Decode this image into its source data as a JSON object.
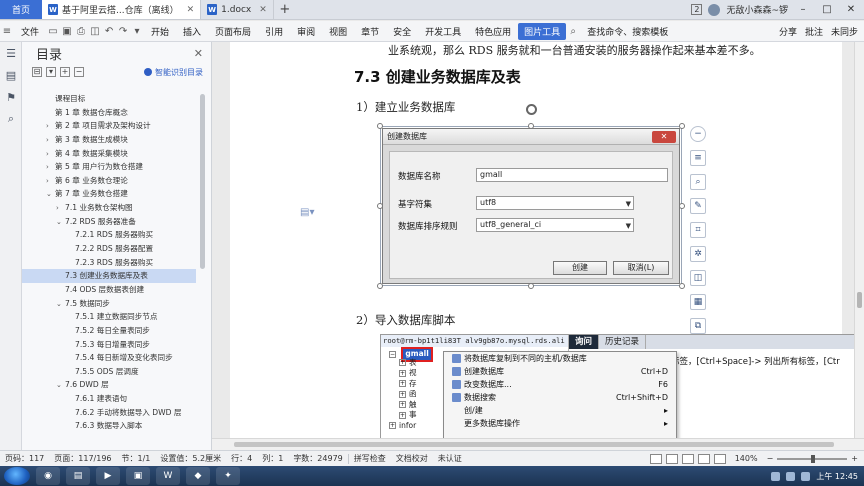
{
  "tabbar": {
    "home": "首页",
    "tabs": [
      {
        "label": "基于阿里云搭...仓库（离线）",
        "icon": "W"
      },
      {
        "label": "1.docx",
        "icon": "W"
      }
    ],
    "page_badge": "2",
    "user": "无敌小森森~锣",
    "plus": "+"
  },
  "menubar": {
    "file": "文件",
    "items": [
      "开始",
      "插入",
      "页面布局",
      "引用",
      "审阅",
      "视图",
      "章节",
      "安全",
      "开发工具",
      "特色应用",
      "图片工具"
    ],
    "active": "图片工具",
    "search": "查找命令、搜索模板",
    "share": "分享",
    "comment": "批注",
    "sync": "未同步"
  },
  "toc": {
    "title": "目录",
    "smart": "智能识别目录",
    "items": [
      {
        "label": "课程目标",
        "level": 0,
        "arrow": ""
      },
      {
        "label": "第 1 章 数据仓库概念",
        "level": 0,
        "arrow": ""
      },
      {
        "label": "第 2 章 项目需求及架构设计",
        "level": 0,
        "arrow": "›"
      },
      {
        "label": "第 3 章 数据生成模块",
        "level": 0,
        "arrow": "›"
      },
      {
        "label": "第 4 章 数据采集模块",
        "level": 0,
        "arrow": "›"
      },
      {
        "label": "第 5 章 用户行为数仓搭建",
        "level": 0,
        "arrow": "›"
      },
      {
        "label": "第 6 章 业务数仓理论",
        "level": 0,
        "arrow": "›"
      },
      {
        "label": "第 7 章 业务数仓搭建",
        "level": 0,
        "arrow": "⌄"
      },
      {
        "label": "7.1 业务数仓架构图",
        "level": 1,
        "arrow": "›"
      },
      {
        "label": "7.2 RDS 服务器准备",
        "level": 1,
        "arrow": "⌄"
      },
      {
        "label": "7.2.1 RDS 服务器购买",
        "level": 2,
        "arrow": ""
      },
      {
        "label": "7.2.2 RDS 服务器配置",
        "level": 2,
        "arrow": ""
      },
      {
        "label": "7.2.3 RDS 服务器购买",
        "level": 2,
        "arrow": ""
      },
      {
        "label": "7.3 创建业务数据库及表",
        "level": 1,
        "arrow": "",
        "selected": true
      },
      {
        "label": "7.4 ODS 层数据表创建",
        "level": 1,
        "arrow": ""
      },
      {
        "label": "7.5 数据同步",
        "level": 1,
        "arrow": "⌄"
      },
      {
        "label": "7.5.1 建立数据同步节点",
        "level": 2,
        "arrow": ""
      },
      {
        "label": "7.5.2 每日全量表同步",
        "level": 2,
        "arrow": ""
      },
      {
        "label": "7.5.3 每日增量表同步",
        "level": 2,
        "arrow": ""
      },
      {
        "label": "7.5.4 每日新增及变化表同步",
        "level": 2,
        "arrow": ""
      },
      {
        "label": "7.5.5 ODS 层调度",
        "level": 2,
        "arrow": ""
      },
      {
        "label": "7.6 DWD 层",
        "level": 1,
        "arrow": "⌄"
      },
      {
        "label": "7.6.1 建表语句",
        "level": 2,
        "arrow": ""
      },
      {
        "label": "7.6.2 手动将数据导入 DWD 层",
        "level": 2,
        "arrow": ""
      },
      {
        "label": "7.6.3 数据导入脚本",
        "level": 2,
        "arrow": ""
      }
    ]
  },
  "doc": {
    "cut_text": "业系统观，那么 RDS 服务就和一台普通安装的服务器操作起来基本差不多。",
    "heading": "7.3 创建业务数据库及表",
    "step1": "1）建立业务数据库",
    "step2": "2）导入数据库脚本"
  },
  "dialog": {
    "title": "创建数据库",
    "close": "✕",
    "db_name_label": "数据库名称",
    "db_name_value": "gmall",
    "charset_label": "基字符集",
    "charset_value": "utf8",
    "collation_label": "数据库排序规则",
    "collation_value": "utf8_general_ci",
    "create_btn": "创建",
    "cancel_btn": "取消(L)"
  },
  "sql": {
    "conn": "root@rm-bp1t1li83T alv9gb87o.mysql.rds.ali",
    "db": "gmall",
    "tabs": [
      "询问",
      "历史记录"
    ],
    "hint": "标签，[Ctrl+Space]-> 列出所有标签，[Ctr",
    "tree_nodes": [
      "表",
      "视",
      "存",
      "函",
      "触",
      "事"
    ],
    "info": "infor",
    "menu": [
      {
        "label": "将数据库复制到不同的主机/数据库",
        "shortcut": ""
      },
      {
        "label": "创建数据库",
        "shortcut": "Ctrl+D"
      },
      {
        "label": "改变数据库...",
        "shortcut": "F6"
      },
      {
        "label": "数据搜索",
        "shortcut": "Ctrl+Shift+D"
      },
      {
        "label": "创/建",
        "shortcut": "▸"
      },
      {
        "label": "更多数据库操作",
        "shortcut": "▸"
      }
    ]
  },
  "status": {
    "page": "页码：117",
    "pages": "页面：117/196",
    "section": "节：1/1",
    "setting": "设置值：5.2厘米",
    "row": "行：4",
    "col": "列：1",
    "words": "字数：24979",
    "spell": "拼写检查",
    "proof": "文档校对",
    "cert": "未认证",
    "zoom": "140%"
  },
  "taskbar": {
    "time": "上午 12:45"
  }
}
